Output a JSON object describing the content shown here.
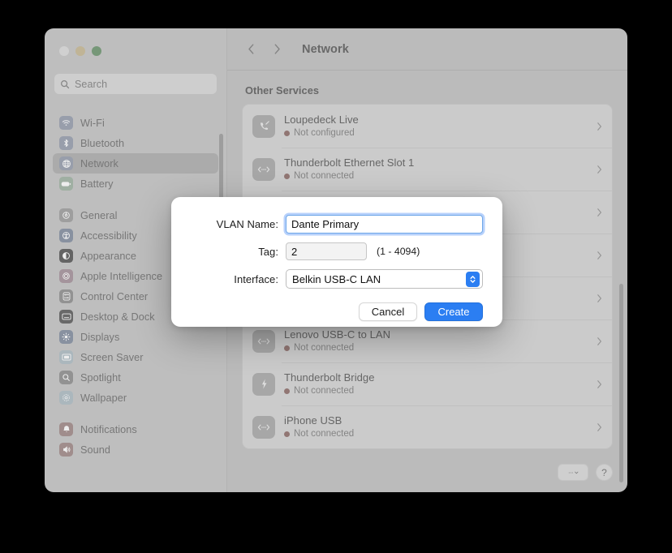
{
  "window": {
    "traffic_lights": [
      "close",
      "minimize",
      "maximize"
    ]
  },
  "sidebar": {
    "search": {
      "placeholder": "Search",
      "value": "",
      "icon": "search-icon"
    },
    "groups": [
      {
        "items": [
          {
            "label": "Wi-Fi",
            "icon": "wifi-icon",
            "color": "#8aa9e8",
            "selected": false
          },
          {
            "label": "Bluetooth",
            "icon": "bluetooth-icon",
            "color": "#8aa9e8",
            "selected": false
          },
          {
            "label": "Network",
            "icon": "globe-icon",
            "color": "#8aa9e8",
            "selected": true
          },
          {
            "label": "Battery",
            "icon": "battery-icon",
            "color": "#7ec98a",
            "selected": false
          }
        ]
      },
      {
        "items": [
          {
            "label": "General",
            "icon": "gear-icon",
            "color": "#a8a8a8",
            "selected": false
          },
          {
            "label": "Accessibility",
            "icon": "accessibility-icon",
            "color": "#6f9ee6",
            "selected": false
          },
          {
            "label": "Appearance",
            "icon": "appearance-icon",
            "color": "#6a6a6a",
            "selected": false
          },
          {
            "label": "Apple Intelligence",
            "icon": "apple-intelligence-icon",
            "color": "#d98fb0",
            "selected": false
          },
          {
            "label": "Control Center",
            "icon": "control-center-icon",
            "color": "#9b9b9b",
            "selected": false
          },
          {
            "label": "Desktop & Dock",
            "icon": "desktop-dock-icon",
            "color": "#6f6f6f",
            "selected": false
          },
          {
            "label": "Displays",
            "icon": "displays-icon",
            "color": "#6f9ee6",
            "selected": false
          },
          {
            "label": "Screen Saver",
            "icon": "screen-saver-icon",
            "color": "#8fc9e8",
            "selected": false
          },
          {
            "label": "Spotlight",
            "icon": "spotlight-icon",
            "color": "#9b9b9b",
            "selected": false
          },
          {
            "label": "Wallpaper",
            "icon": "wallpaper-icon",
            "color": "#8fc9e8",
            "selected": false
          }
        ]
      },
      {
        "items": [
          {
            "label": "Notifications",
            "icon": "notifications-icon",
            "color": "#e4867f",
            "selected": false
          },
          {
            "label": "Sound",
            "icon": "sound-icon",
            "color": "#e4867f",
            "selected": false
          }
        ]
      }
    ]
  },
  "toolbar": {
    "back_icon": "chevron-left-icon",
    "forward_icon": "chevron-right-icon",
    "title": "Network"
  },
  "main": {
    "section_title": "Other Services",
    "services": [
      {
        "name": "Loupedeck Live",
        "status": "Not configured",
        "icon": "phone-off-icon",
        "status_color": "#e8685b"
      },
      {
        "name": "Thunderbolt Ethernet Slot 1",
        "status": "Not connected",
        "icon": "ethernet-icon",
        "status_color": "#e8685b"
      },
      {
        "name": "",
        "status": "",
        "icon": "ethernet-icon",
        "status_color": "#e8685b"
      },
      {
        "name": "",
        "status": "",
        "icon": "ethernet-icon",
        "status_color": "#e8685b"
      },
      {
        "name": "",
        "status": "",
        "icon": "ethernet-icon",
        "status_color": "#e8685b"
      },
      {
        "name": "Lenovo USB-C to LAN",
        "status": "Not connected",
        "icon": "ethernet-icon",
        "status_color": "#e8685b"
      },
      {
        "name": "Thunderbolt Bridge",
        "status": "Not connected",
        "icon": "bolt-icon",
        "status_color": "#e8685b"
      },
      {
        "name": "iPhone USB",
        "status": "Not connected",
        "icon": "ethernet-icon",
        "status_color": "#e8685b"
      }
    ],
    "more_button_label": "",
    "help_button_label": "?"
  },
  "dialog": {
    "name_label": "VLAN Name:",
    "name_value": "Dante Primary",
    "tag_label": "Tag:",
    "tag_value": "2",
    "tag_hint": "(1 - 4094)",
    "interface_label": "Interface:",
    "interface_value": "Belkin USB-C LAN",
    "cancel_label": "Cancel",
    "create_label": "Create"
  },
  "colors": {
    "accent": "#2b7ef2",
    "status_red": "#e8685b",
    "traffic_yellow": "#f6bc2f",
    "traffic_green": "#23c231",
    "traffic_grey": "#dcdcdc"
  }
}
